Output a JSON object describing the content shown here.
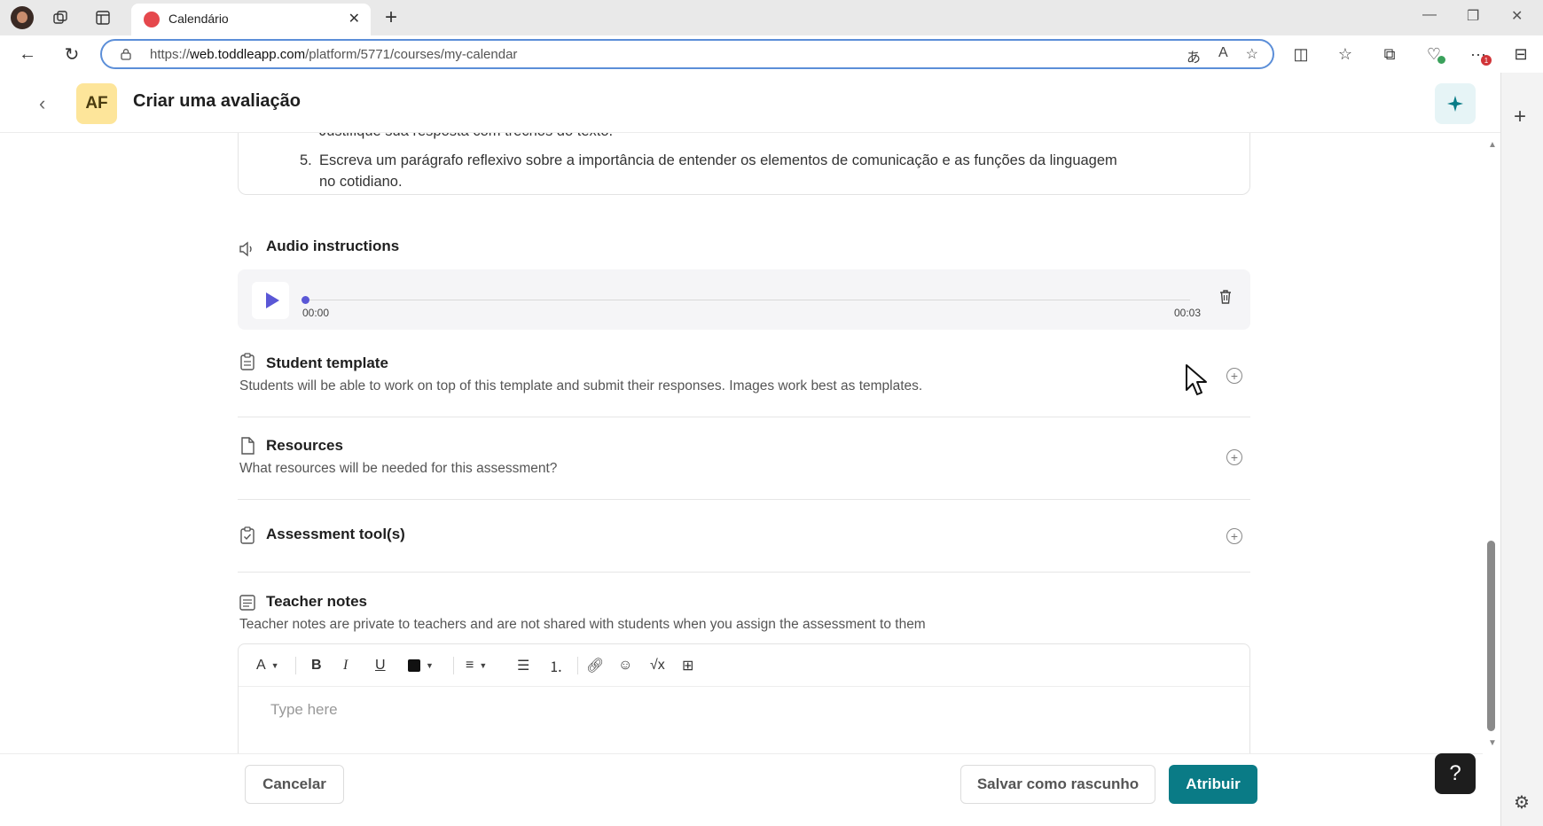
{
  "browser": {
    "tab_title": "Calendário",
    "url_prefix": "https://",
    "url_host": "web.toddleapp.com",
    "url_path": "/platform/5771/courses/my-calendar",
    "notification_count": "1"
  },
  "header": {
    "avatar_initials": "AF",
    "title": "Criar uma avaliação"
  },
  "instructions": {
    "clipped_line": "Justifique sua resposta com trechos do texto.",
    "item_number": "5.",
    "item_text": "Escreva um parágrafo reflexivo sobre a importância de entender os elementos de comunicação e as funções da linguagem no cotidiano."
  },
  "audio": {
    "title": "Audio instructions",
    "current_time": "00:00",
    "duration": "00:03",
    "progress": 0
  },
  "student_template": {
    "title": "Student template",
    "description": "Students will be able to work on top of this template and submit their responses. Images work best as templates."
  },
  "resources": {
    "title": "Resources",
    "description": "What resources will be needed for this assessment?"
  },
  "assessment_tools": {
    "title": "Assessment tool(s)"
  },
  "teacher_notes": {
    "title": "Teacher notes",
    "description": "Teacher notes are private to teachers and are not shared with students when you assign the assessment to them",
    "placeholder": "Type here"
  },
  "footer": {
    "cancel_label": "Cancelar",
    "draft_label": "Salvar como rascunho",
    "assign_label": "Atribuir"
  },
  "help_label": "?",
  "colors": {
    "accent": "#0a7b86",
    "audio_accent": "#5a57d6",
    "avatar_bg": "#fde59a"
  }
}
